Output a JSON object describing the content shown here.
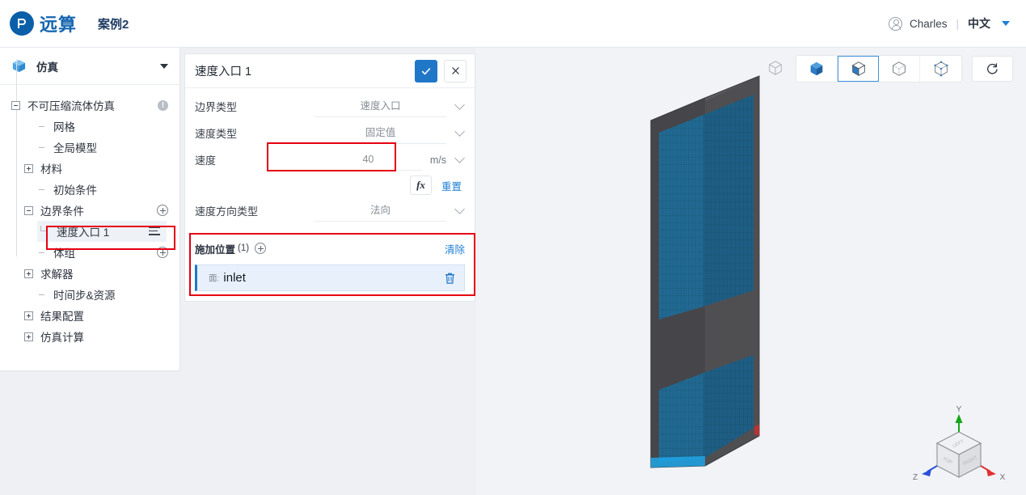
{
  "topbar": {
    "logo_glyph": "卩",
    "logo_text": "远算",
    "case_name": "案例2",
    "user_name": "Charles",
    "divider": "|",
    "language": "中文",
    "avatar_icon": "user-circle-icon",
    "caret_icon": "chevron-down-icon"
  },
  "sidebar": {
    "header": {
      "label": "仿真",
      "icon": "cube-icon",
      "caret": "chevron-down-icon"
    },
    "tree": [
      {
        "label": "不可压缩流体仿真",
        "level": 0,
        "toggle": "minus",
        "right_icon": "info-icon"
      },
      {
        "label": "网格",
        "level": 1,
        "toggle": "leaf",
        "right_icon": ""
      },
      {
        "label": "全局模型",
        "level": 1,
        "toggle": "leaf",
        "right_icon": ""
      },
      {
        "label": "材料",
        "level": 0,
        "toggle": "plus",
        "right_icon": ""
      },
      {
        "label": "初始条件",
        "level": 1,
        "toggle": "leaf",
        "right_icon": ""
      },
      {
        "label": "边界条件",
        "level": 0,
        "toggle": "minus",
        "right_icon": "plus-circle-icon"
      },
      {
        "label": "速度入口 1",
        "level": 2,
        "toggle": "leaf",
        "right_icon": "menu-icon",
        "selected": true
      },
      {
        "label": "体组",
        "level": 1,
        "toggle": "leaf",
        "right_icon": "plus-circle-icon"
      },
      {
        "label": "求解器",
        "level": 0,
        "toggle": "plus",
        "right_icon": ""
      },
      {
        "label": "时间步&资源",
        "level": 1,
        "toggle": "leaf",
        "right_icon": ""
      },
      {
        "label": "结果配置",
        "level": 0,
        "toggle": "plus",
        "right_icon": ""
      },
      {
        "label": "仿真计算",
        "level": 0,
        "toggle": "plus",
        "right_icon": ""
      }
    ]
  },
  "panel": {
    "title": "速度入口 1",
    "confirm_icon": "check-icon",
    "cancel_icon": "close-icon",
    "fields": [
      {
        "label": "边界类型",
        "value": "速度入口",
        "unit": "",
        "chevron": true
      },
      {
        "label": "速度类型",
        "value": "固定值",
        "unit": "",
        "chevron": true
      },
      {
        "label": "速度",
        "value": "40",
        "unit": "m/s",
        "chevron": true,
        "highlighted": true
      },
      {
        "label": "速度方向类型",
        "value": "法向",
        "unit": "",
        "chevron": true
      }
    ],
    "fx_label": "fx",
    "reset_label": "重置",
    "location": {
      "title": "施加位置",
      "count": "(1)",
      "add_icon": "plus-circle-icon",
      "clear_label": "清除",
      "items": [
        {
          "kind": "面:",
          "name": "inlet",
          "delete_icon": "trash-icon"
        }
      ]
    }
  },
  "viewport": {
    "toolbar": [
      {
        "name": "wireframe-cube-icon",
        "style": "plain",
        "active": false
      },
      {
        "name": "solid-shaded-cube-icon",
        "style": "button",
        "active": false
      },
      {
        "name": "shaded-edges-cube-icon",
        "style": "button",
        "active": true
      },
      {
        "name": "hidden-line-cube-icon",
        "style": "button",
        "active": false
      },
      {
        "name": "wireframe-points-cube-icon",
        "style": "button",
        "active": false
      },
      {
        "name": "reset-view-icon",
        "style": "single",
        "active": false
      }
    ],
    "axis": {
      "x_label": "X",
      "y_label": "Y",
      "z_label": "Z",
      "x_color": "#e03030",
      "y_color": "#16a616",
      "z_color": "#2a50d8",
      "face_top": "TOP",
      "face_left": "LEFT",
      "face_right": "RIGHT"
    },
    "model": {
      "body_color": "#4a4a4d",
      "mesh_color": "#1f6b96",
      "background": "#f1f3f6"
    }
  },
  "annotations": {
    "color": "#e60012",
    "boxes": [
      {
        "name": "velocity-field-highlight"
      },
      {
        "name": "sidebar-selected-highlight"
      },
      {
        "name": "location-section-highlight"
      }
    ]
  }
}
